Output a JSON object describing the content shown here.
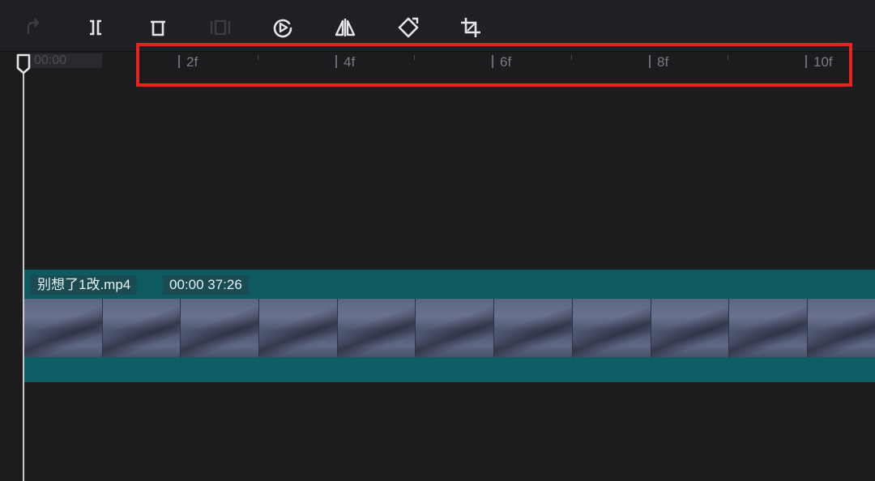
{
  "toolbar": {
    "tools": [
      {
        "name": "redo-icon",
        "enabled": false
      },
      {
        "name": "split-icon",
        "enabled": true
      },
      {
        "name": "delete-icon",
        "enabled": true
      },
      {
        "name": "freeze-frame-icon",
        "enabled": false
      },
      {
        "name": "reverse-play-icon",
        "enabled": true
      },
      {
        "name": "mirror-icon",
        "enabled": true
      },
      {
        "name": "rotate-icon",
        "enabled": true
      },
      {
        "name": "crop-icon",
        "enabled": true
      }
    ]
  },
  "ruler": {
    "start_time": "00:00",
    "labels": [
      "2f",
      "4f",
      "6f",
      "8f",
      "10f"
    ]
  },
  "clip": {
    "filename": "别想了1改.mp4",
    "duration": "00:00 37:26"
  },
  "colors": {
    "background": "#1c1c1f",
    "clip": "#0f5b62",
    "highlight": "#e8241c",
    "playhead": "#c9c9cc"
  }
}
